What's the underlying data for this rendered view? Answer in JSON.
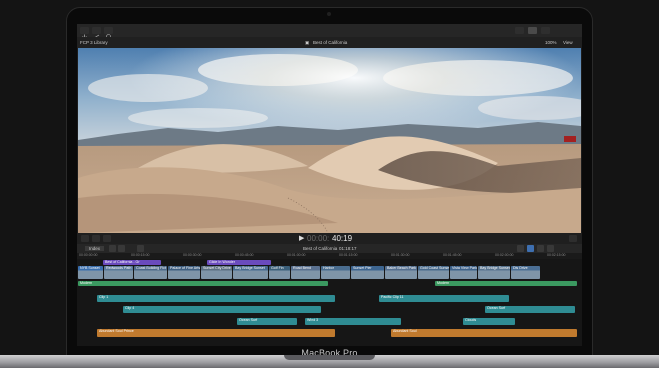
{
  "device": {
    "brand": "MacBook Pro"
  },
  "app": {
    "library_name": "FCP 3 Library",
    "project_title": "Best of California",
    "zoom": "100%",
    "view_menu": "View"
  },
  "viewer": {
    "scene": "desert-sand-dunes"
  },
  "transport": {
    "timecode": "00:00:40:19",
    "timecode_dim": "00:00:",
    "timecode_bright": "40:19"
  },
  "timeline_header": {
    "index_label": "Index",
    "project_title": "Best of California",
    "duration": "01:18:17"
  },
  "ruler_ticks": [
    "00:00:00:00",
    "00:00:15:00",
    "00:00:30:00",
    "00:00:45:00",
    "00:01:00:00",
    "00:01:15:00",
    "00:01:30:00",
    "00:01:45:00",
    "00:02:00:00",
    "00:02:15:00"
  ],
  "titles_track": [
    "Best of California - Gr",
    "Glide In Wonder"
  ],
  "video_clips": [
    {
      "label": "NYB Sunset",
      "color": "#3a6fae"
    },
    {
      "label": "Redwoods Path",
      "color": "#5a7a9a"
    },
    {
      "label": "Coast Building Fict 2",
      "color": "#4d6a8a"
    },
    {
      "label": "Palace of Fine Arts",
      "color": "#3f5f80"
    },
    {
      "label": "Sunset City Drive",
      "color": "#5b6f82"
    },
    {
      "label": "Bay Bridge Sunset",
      "color": "#476b8f"
    },
    {
      "label": "Golf Fin",
      "color": "#3b5f7a"
    },
    {
      "label": "Road Bend",
      "color": "#5a7190"
    },
    {
      "label": "Harbor",
      "color": "#4a6d8f"
    },
    {
      "label": "Sunset Pier",
      "color": "#3d6590"
    },
    {
      "label": "Baker Beach Park",
      "color": "#557090"
    },
    {
      "label": "Gold Coast Sunset",
      "color": "#486a8c"
    },
    {
      "label": "Vista View Park",
      "color": "#3e628a"
    },
    {
      "label": "Bay Bridge Sunset",
      "color": "#58748f"
    },
    {
      "label": "Dis Drive",
      "color": "#4b6f95"
    }
  ],
  "audio_tracks": {
    "green_1": "Modern",
    "green_2": "Modern",
    "teal_1": "Clip 1",
    "teal_2": "Pacific Clip 11",
    "teal_3": "Clip 4",
    "teal_4": "Ocean Surf",
    "teal_5": "Ocean Surf",
    "teal_6": "Wind 3",
    "teal_7": "Clouds",
    "orange_1": "Abundant Soul Prince",
    "orange_2": "Abundant Soul"
  },
  "colors": {
    "video_clip_blue": "#3a6fae",
    "audio_green": "#3b9960",
    "audio_teal": "#2f8c93",
    "music_orange": "#c07a2e",
    "title_purple": "#6a4bbd"
  }
}
